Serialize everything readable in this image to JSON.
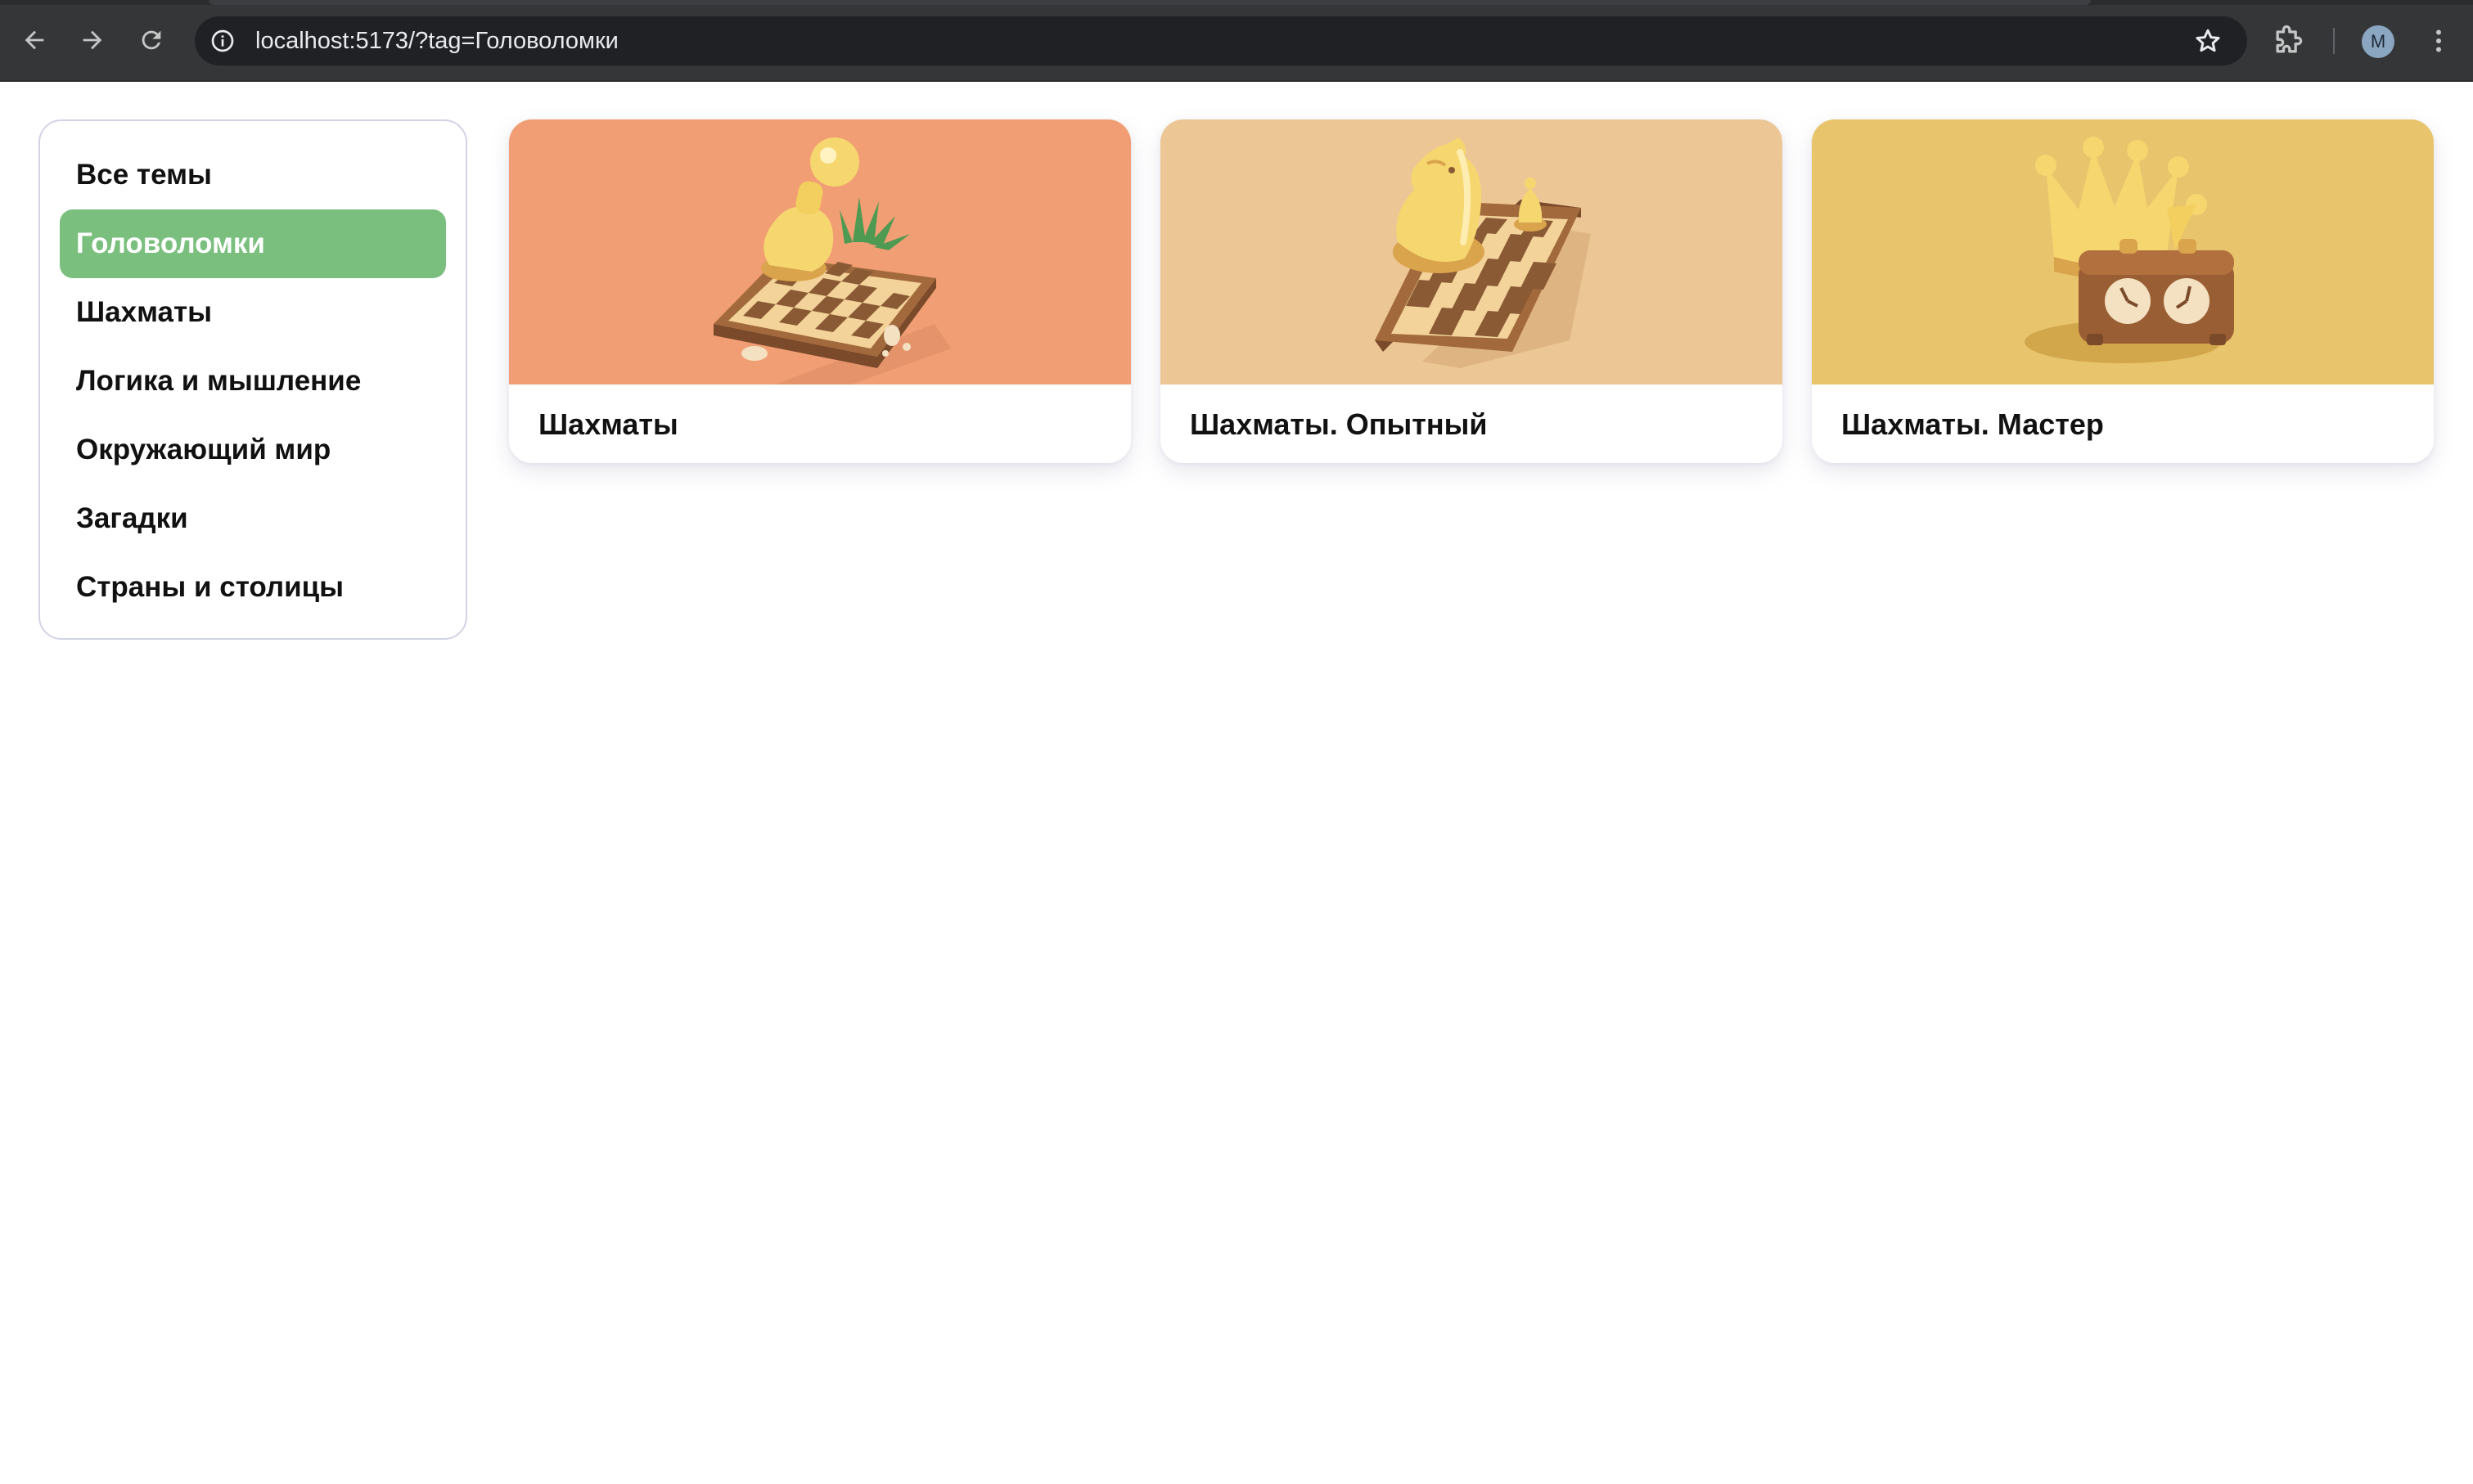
{
  "browser": {
    "url": "localhost:5173/?tag=Головоломки",
    "profile_initial": "M",
    "icons": {
      "back": "arrow-left-icon",
      "forward": "arrow-right-icon",
      "reload": "reload-icon",
      "site_info": "info-icon",
      "bookmark": "star-icon",
      "extensions": "puzzle-icon",
      "menu": "kebab-menu-icon"
    }
  },
  "sidebar": {
    "items": [
      {
        "label": "Все темы",
        "active": false
      },
      {
        "label": "Головоломки",
        "active": true
      },
      {
        "label": "Шахматы",
        "active": false
      },
      {
        "label": "Логика и мышление",
        "active": false
      },
      {
        "label": "Окружающий мир",
        "active": false
      },
      {
        "label": "Загадки",
        "active": false
      },
      {
        "label": "Страны и столицы",
        "active": false
      }
    ]
  },
  "cards": [
    {
      "title": "Шахматы",
      "bg_color": "#f19e74",
      "illustration": "pawn-on-chessboard"
    },
    {
      "title": "Шахматы. Опытный",
      "bg_color": "#ecc695",
      "illustration": "knight-on-chessboard"
    },
    {
      "title": "Шахматы. Мастер",
      "bg_color": "#e8c46c",
      "illustration": "crown-and-chess-clock"
    }
  ],
  "colors": {
    "active_item": "#7abf7e",
    "sidebar_border": "#d2d3e6",
    "chrome_bg": "#353638",
    "omnibox_bg": "#202124"
  }
}
